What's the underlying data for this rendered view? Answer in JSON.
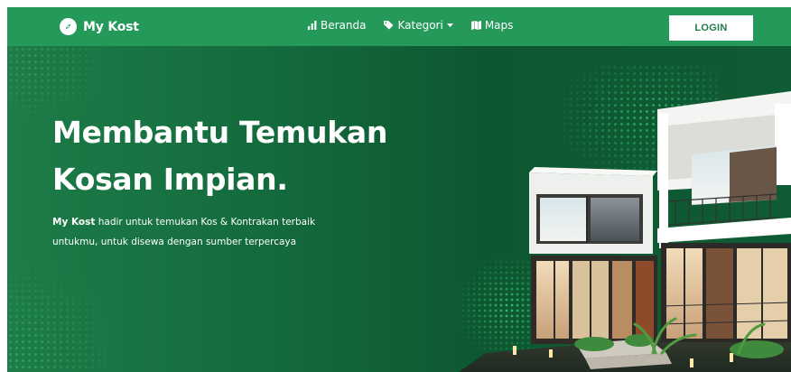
{
  "navbar": {
    "brand": "My Kost",
    "links": [
      {
        "label": "Beranda",
        "icon": "bar-chart-icon"
      },
      {
        "label": "Kategori",
        "icon": "tag-icon"
      },
      {
        "label": "Maps",
        "icon": "map-icon"
      }
    ],
    "login_label": "LOGIN"
  },
  "hero": {
    "headline_line1": "Membantu Temukan",
    "headline_line2": "Kosan Impian.",
    "subtitle_brand": "My Kost",
    "subtitle_rest": " hadir untuk temukan Kos & Kontrakan terbaik",
    "subtitle_line2": "untukmu, untuk disewa dengan sumber terpercaya"
  },
  "colors": {
    "navbar_bg": "#24995a",
    "hero_bg": "#136a3c",
    "login_text": "#1e7a49"
  }
}
